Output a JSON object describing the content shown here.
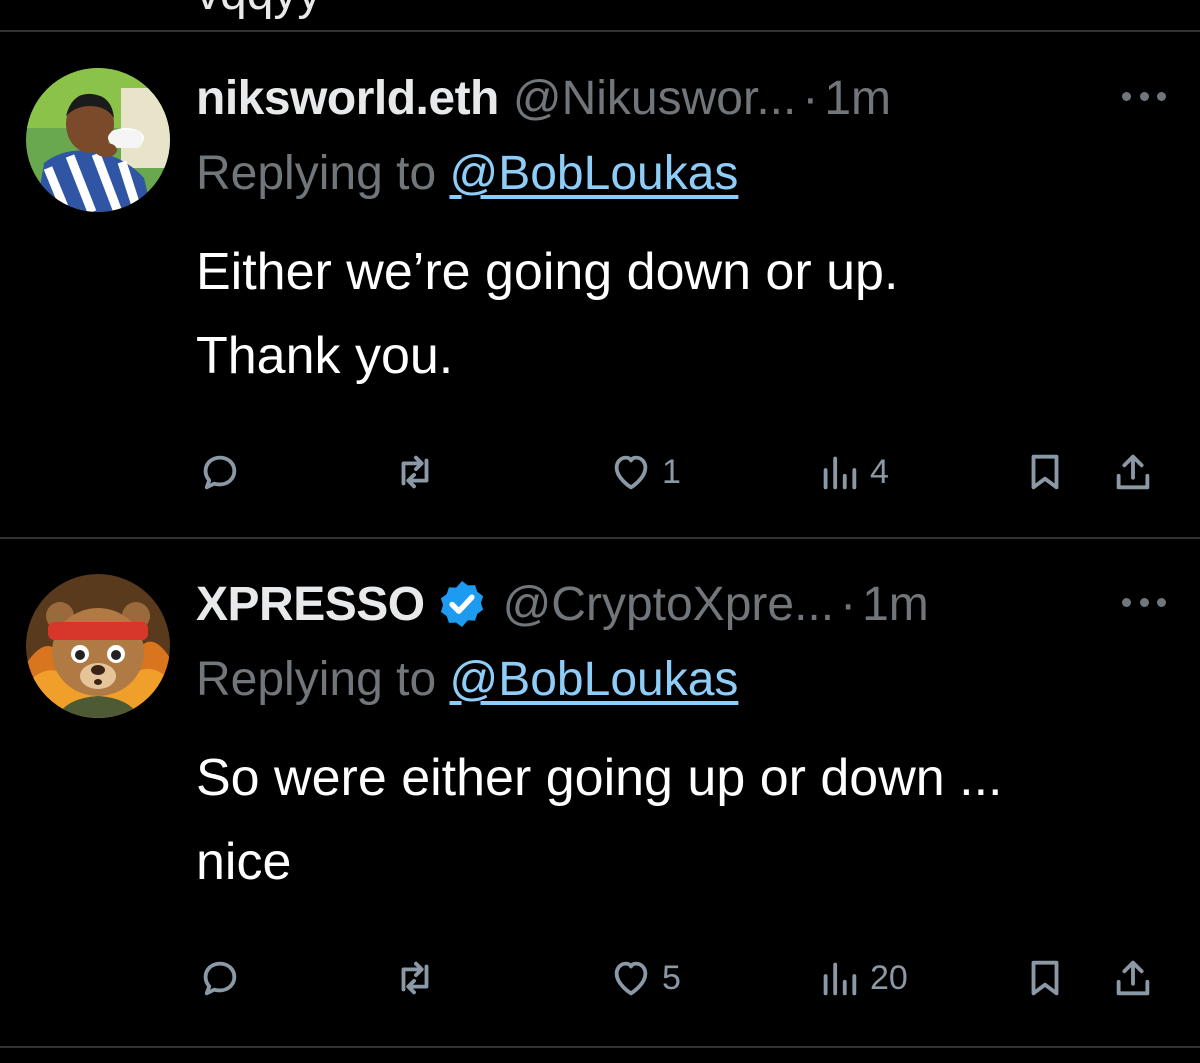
{
  "top_fragment": "vqqyy",
  "tweets": [
    {
      "display_name": "niksworld.eth",
      "verified": false,
      "handle": "@Nikuswor...",
      "separator": "·",
      "time": "1m",
      "replying_prefix": "Replying to",
      "replying_to": "@BobLoukas",
      "text_lines": [
        "Either we’re going down or up.",
        "Thank you."
      ],
      "metrics": {
        "replies": "",
        "reposts": "",
        "likes": "1",
        "views": "4"
      }
    },
    {
      "display_name": "XPRESSO",
      "verified": true,
      "handle": "@CryptoXpre...",
      "separator": "·",
      "time": "1m",
      "replying_prefix": "Replying to",
      "replying_to": "@BobLoukas",
      "text_lines": [
        "So were either going up or down ...",
        "nice"
      ],
      "metrics": {
        "replies": "",
        "reposts": "",
        "likes": "5",
        "views": "20"
      }
    }
  ],
  "icons": {
    "more": "more-horizontal-icon",
    "reply": "reply-icon",
    "repost": "repost-icon",
    "like": "heart-icon",
    "views": "views-icon",
    "bookmark": "bookmark-icon",
    "share": "share-icon",
    "verified": "verified-badge-icon"
  },
  "colors": {
    "background": "#000000",
    "text": "#e7e9ea",
    "muted": "#71767b",
    "mention": "#8ecdf8",
    "verified": "#1d9bf0",
    "divider": "#2f3336"
  }
}
